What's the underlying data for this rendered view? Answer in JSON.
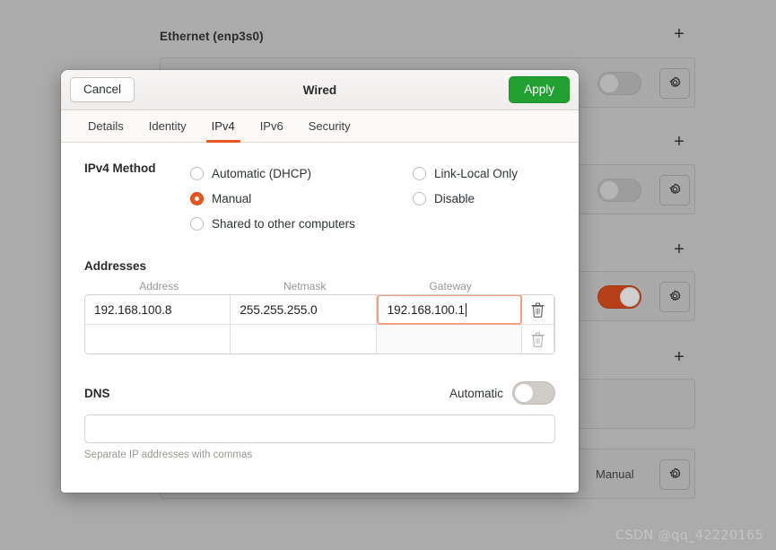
{
  "background": {
    "section_title": "Ethernet (enp3s0)",
    "add_icon": "plus-icon",
    "gear_icon": "gear-icon",
    "plus_label": "+",
    "rows": [
      {
        "toggle_on": false,
        "label": ""
      },
      {
        "toggle_on": false,
        "label": ""
      },
      {
        "toggle_on": true,
        "label": ""
      },
      {
        "toggle_on": null,
        "label": ""
      },
      {
        "toggle_on": null,
        "label": "Manual"
      }
    ],
    "accent_on_color": "#b5401a"
  },
  "watermark": "CSDN @qq_42220165",
  "dialog": {
    "title": "Wired",
    "cancel_label": "Cancel",
    "apply_label": "Apply",
    "apply_color": "#22a031",
    "accent_color": "#e8551f",
    "tabs": [
      {
        "label": "Details",
        "active": false
      },
      {
        "label": "Identity",
        "active": false
      },
      {
        "label": "IPv4",
        "active": true
      },
      {
        "label": "IPv6",
        "active": false
      },
      {
        "label": "Security",
        "active": false
      }
    ],
    "method": {
      "label": "IPv4 Method",
      "column_a": [
        {
          "label": "Automatic (DHCP)",
          "checked": false
        },
        {
          "label": "Manual",
          "checked": true
        },
        {
          "label": "Shared to other computers",
          "checked": false
        }
      ],
      "column_b": [
        {
          "label": "Link-Local Only",
          "checked": false
        },
        {
          "label": "Disable",
          "checked": false
        }
      ]
    },
    "addresses": {
      "label": "Addresses",
      "headers": [
        "Address",
        "Netmask",
        "Gateway"
      ],
      "delete_icon": "trash-icon",
      "rows": [
        {
          "address": "192.168.100.8",
          "netmask": "255.255.255.0",
          "gateway": "192.168.100.1",
          "focused_field": "gateway"
        },
        {
          "address": "",
          "netmask": "",
          "gateway": "",
          "focused_field": ""
        }
      ]
    },
    "dns": {
      "label": "DNS",
      "automatic_label": "Automatic",
      "automatic_on": false,
      "value": "",
      "placeholder": "",
      "hint": "Separate IP addresses with commas"
    }
  }
}
